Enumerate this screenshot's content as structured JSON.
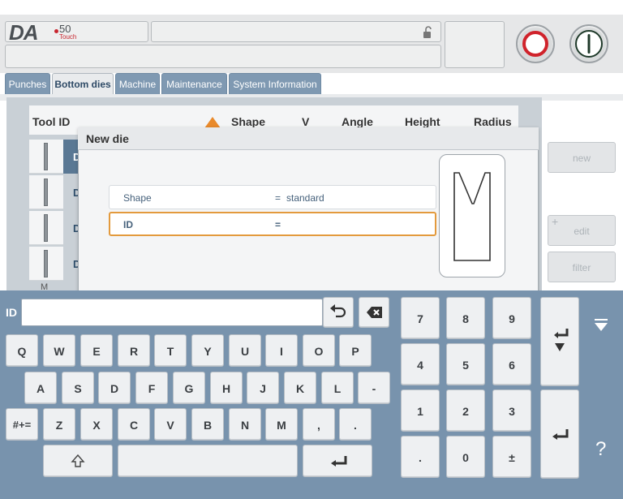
{
  "header": {
    "logo_da": "DA",
    "logo_num": "50",
    "logo_touch": "Touch",
    "lock_icon": "unlock-icon",
    "stop_icon": "stop-icon",
    "start_icon": "start-icon"
  },
  "tabs": [
    {
      "label": "Punches"
    },
    {
      "label": "Bottom dies"
    },
    {
      "label": "Machine"
    },
    {
      "label": "Maintenance"
    },
    {
      "label": "System Information"
    }
  ],
  "table": {
    "columns": [
      "Tool ID",
      "Shape",
      "V",
      "Angle",
      "Height",
      "Radius"
    ],
    "row_partial_letters": [
      "D",
      "D",
      "D",
      "D"
    ],
    "last_row_letter": "M",
    "sort_icon": "sort-up-icon"
  },
  "side_buttons": {
    "new": "new",
    "edit": "edit",
    "edit_plus": "+",
    "filter": "filter"
  },
  "dialog": {
    "title": "New die",
    "fields": [
      {
        "label": "Shape",
        "eq": "=",
        "value": "standard"
      },
      {
        "label": "ID",
        "eq": "=",
        "value": ""
      }
    ]
  },
  "keyboard": {
    "field_label": "ID",
    "input_value": "",
    "undo_icon": "undo-icon",
    "backspace_icon": "backspace-icon",
    "row1": [
      "Q",
      "W",
      "E",
      "R",
      "T",
      "Y",
      "U",
      "I",
      "O",
      "P"
    ],
    "row2": [
      "A",
      "S",
      "D",
      "F",
      "G",
      "H",
      "J",
      "K",
      "L",
      "-"
    ],
    "row3": [
      "Z",
      "X",
      "C",
      "V",
      "B",
      "N",
      "M",
      ",",
      "."
    ],
    "symbols": "#+=",
    "shift_icon": "shift-icon",
    "enter_icon": "enter-icon",
    "numpad": [
      "7",
      "8",
      "9",
      "4",
      "5",
      "6",
      "1",
      "2",
      "3",
      ".",
      "0",
      "±"
    ],
    "tab_icon": "tab-icon",
    "hide_icon": "hide-keyboard-icon",
    "help": "?"
  }
}
